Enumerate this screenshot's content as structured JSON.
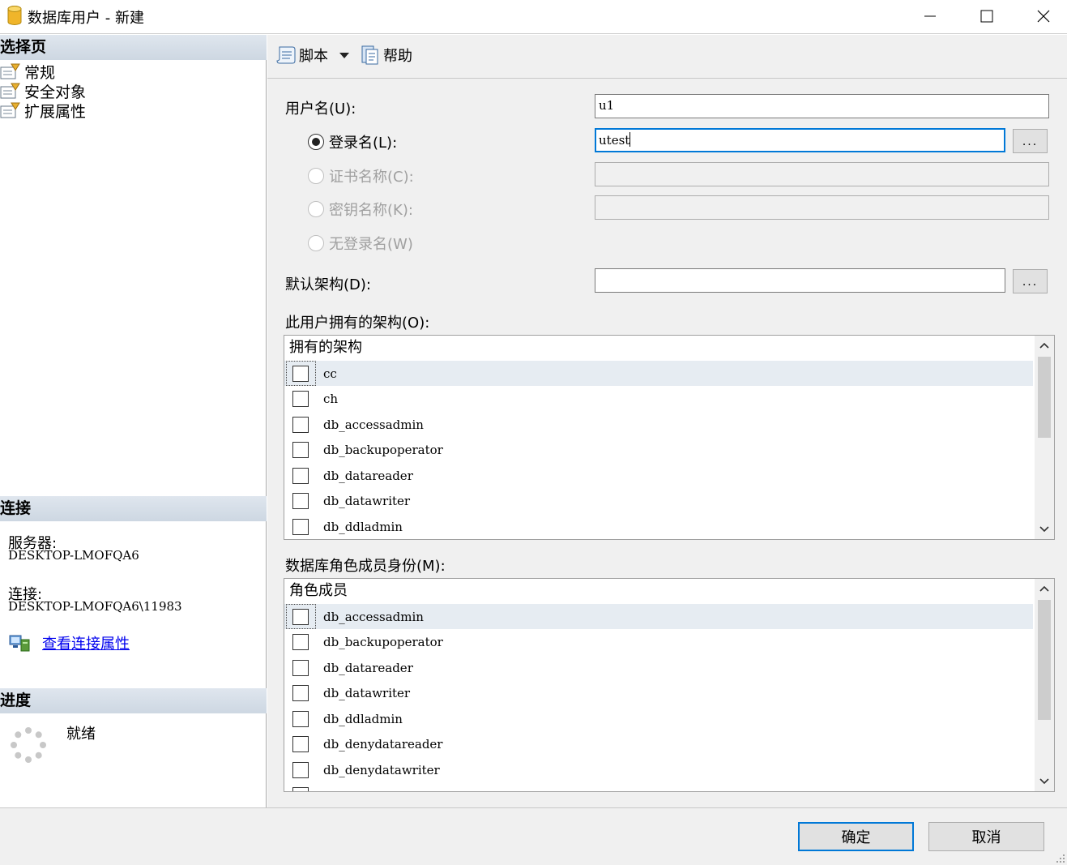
{
  "window": {
    "title": "数据库用户 - 新建",
    "minimize_icon": "minimize-icon",
    "maximize_icon": "maximize-icon",
    "close_icon": "close-icon"
  },
  "left": {
    "select_page_header": "选择页",
    "pages": [
      {
        "label": "常规",
        "icon": "page-icon"
      },
      {
        "label": "安全对象",
        "icon": "page-icon"
      },
      {
        "label": "扩展属性",
        "icon": "page-icon"
      }
    ],
    "connection_header": "连接",
    "server_label": "服务器:",
    "server_value": "DESKTOP-LMOFQA6",
    "connection_label": "连接:",
    "connection_value": "DESKTOP-LMOFQA6\\11983",
    "view_props_link": "查看连接属性",
    "progress_header": "进度",
    "progress_status": "就绪"
  },
  "toolbar": {
    "script_label": "脚本",
    "help_label": "帮助"
  },
  "form": {
    "username_label": "用户名(U):",
    "username_value": "u1",
    "login_label": "登录名(L):",
    "login_value": "utest",
    "cert_label": "证书名称(C):",
    "key_label": "密钥名称(K):",
    "nologin_label": "无登录名(W)",
    "default_schema_label": "默认架构(D):",
    "default_schema_value": "",
    "browse_label": "...",
    "owned_schemas_label": "此用户拥有的架构(O):",
    "owned_schemas_header": "拥有的架构",
    "owned_schemas": [
      "cc",
      "ch",
      "db_accessadmin",
      "db_backupoperator",
      "db_datareader",
      "db_datawriter",
      "db_ddladmin"
    ],
    "roles_label": "数据库角色成员身份(M):",
    "roles_header": "角色成员",
    "roles": [
      "db_accessadmin",
      "db_backupoperator",
      "db_datareader",
      "db_datawriter",
      "db_ddladmin",
      "db_denydatareader",
      "db_denydatawriter"
    ]
  },
  "buttons": {
    "ok": "确定",
    "cancel": "取消"
  }
}
